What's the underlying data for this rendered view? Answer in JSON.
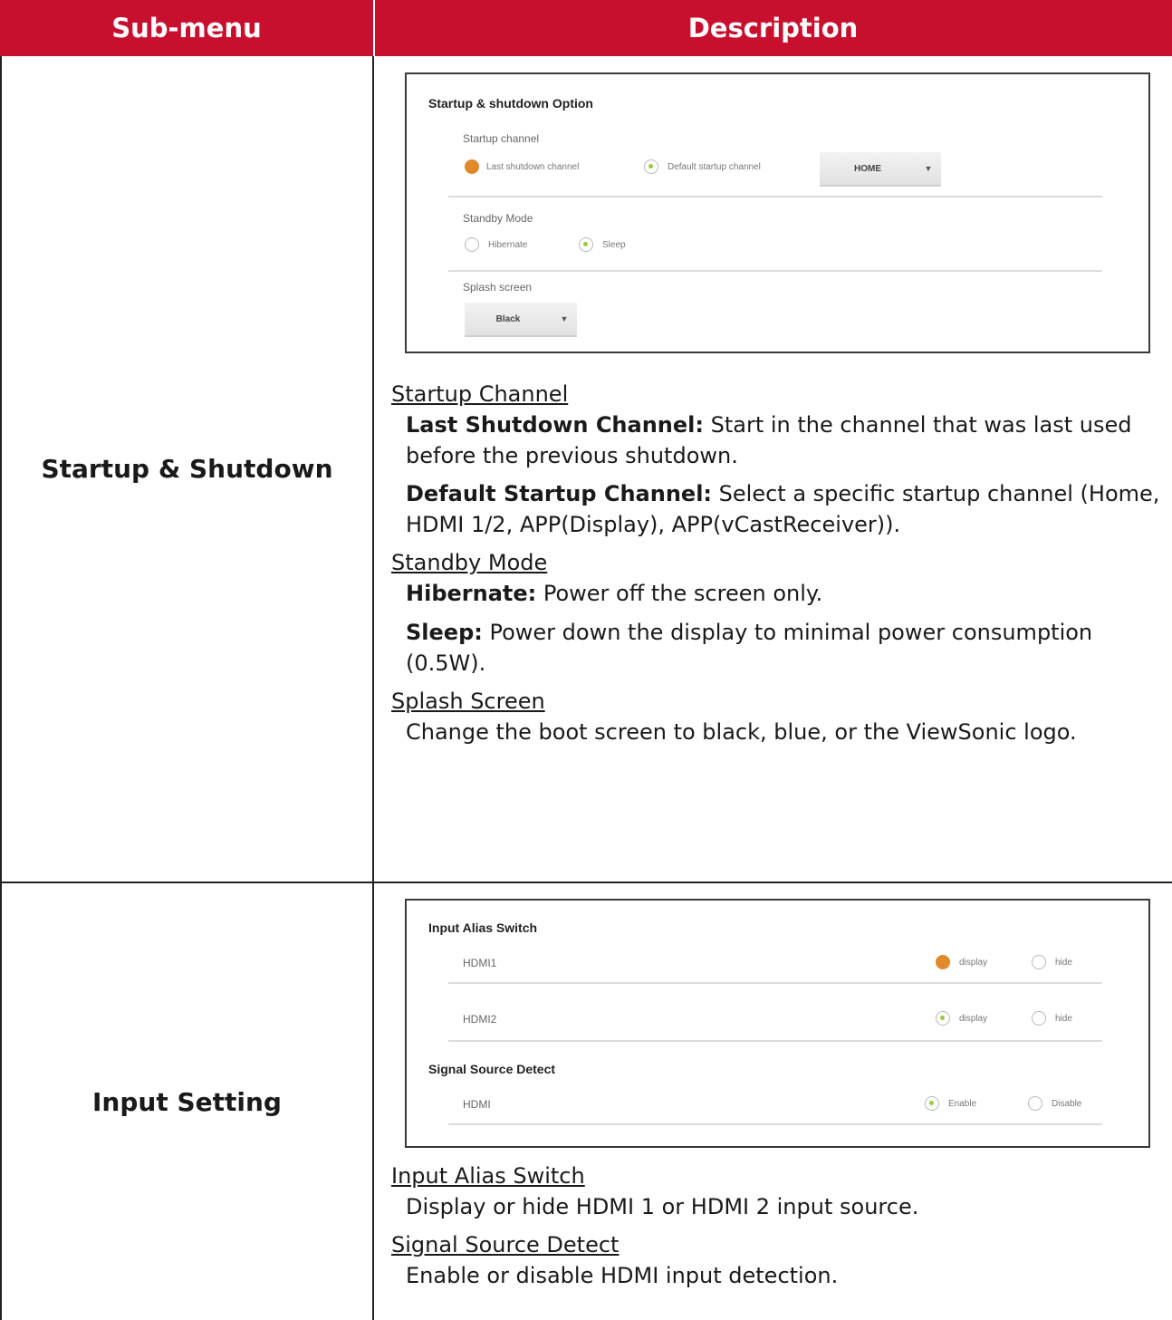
{
  "header": {
    "col_submenu": "Sub-menu",
    "col_description": "Description"
  },
  "startup": {
    "submenu": "Startup & Shutdown",
    "screenshot": {
      "title": "Startup & shutdown Option",
      "startup_channel_label": "Startup channel",
      "opt_last": "Last shutdown channel",
      "opt_default": "Default startup channel",
      "channel_value": "HOME",
      "standby_label": "Standby Mode",
      "opt_hibernate": "Hibernate",
      "opt_sleep": "Sleep",
      "splash_label": "Splash screen",
      "splash_value": "Black"
    },
    "sections": {
      "startup_channel": "Startup Channel",
      "last_label": "Last Shutdown Channel:",
      "last_text": " Start in the channel that was last used before the previous shutdown.",
      "default_label": "Default Startup Channel:",
      "default_text": " Select a specific startup channel (Home, HDMI 1/2, APP(Display), APP(vCastReceiver)).",
      "standby_mode": "Standby Mode",
      "hibernate_label": "Hibernate:",
      "hibernate_text": " Power off the screen only.",
      "sleep_label": "Sleep:",
      "sleep_text": " Power down the display to minimal power consumption (0.5W).",
      "splash_screen": "Splash Screen",
      "splash_text": "Change the boot screen to black, blue, or the ViewSonic logo."
    }
  },
  "input": {
    "submenu": "Input Setting",
    "screenshot": {
      "title": "Input Alias Switch",
      "hdmi1": "HDMI1",
      "hdmi2": "HDMI2",
      "display": "display",
      "hide": "hide",
      "signal_title": "Signal Source Detect",
      "hdmi": "HDMI",
      "enable": "Enable",
      "disable": "Disable"
    },
    "sections": {
      "alias_switch": "Input Alias Switch",
      "alias_text": "Display or hide HDMI 1 or HDMI 2 input source.",
      "signal_detect": "Signal Source Detect",
      "signal_text": "Enable or disable HDMI input detection."
    }
  },
  "colors": {
    "header_bg": "#c8102e",
    "accent_orange": "#e08a2c",
    "accent_green": "#9acb3c"
  }
}
